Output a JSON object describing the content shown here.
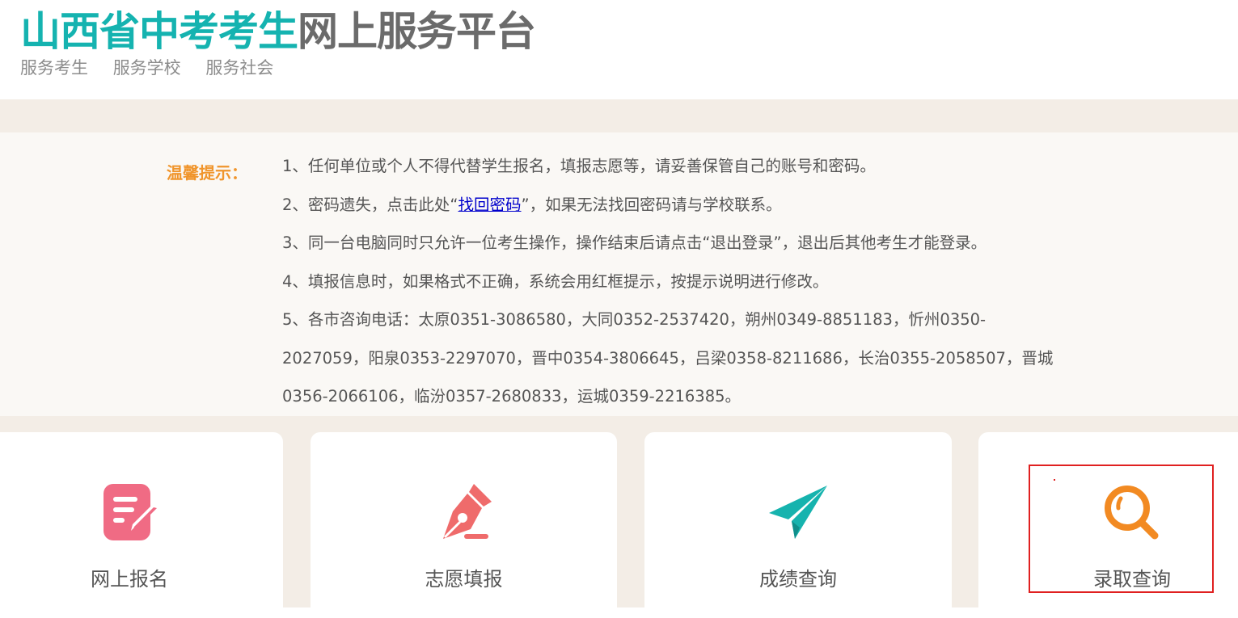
{
  "header": {
    "title_part1": "山西省中考考生",
    "title_part2": "网上服务平台",
    "subnav": [
      "服务考生",
      "服务学校",
      "服务社会"
    ]
  },
  "notice": {
    "label": "温馨提示：",
    "line1": "1、任何单位或个人不得代替学生报名，填报志愿等，请妥善保管自己的账号和密码。",
    "line2_before": "2、密码遗失，点击此处“",
    "line2_link": "找回密码",
    "line2_after": "”，如果无法找回密码请与学校联系。",
    "line3": "3、同一台电脑同时只允许一位考生操作，操作结束后请点击“退出登录”，退出后其他考生才能登录。",
    "line4": "4、填报信息时，如果格式不正确，系统会用红框提示，按提示说明进行修改。",
    "line5": "5、各市咨询电话：太原0351-3086580，大同0352-2537420，朔州0349-8851183，忻州0350-2027059，阳泉0353-2297070，晋中0354-3806645，吕梁0358-8211686，长治0355-2058507，晋城0356-2066106，临汾0357-2680833，运城0359-2216385。"
  },
  "cards": [
    {
      "label": "网上报名",
      "icon": "registration-icon",
      "color": "#f06b84"
    },
    {
      "label": "志愿填报",
      "icon": "fountain-pen-icon",
      "color": "#ef6b6b"
    },
    {
      "label": "成绩查询",
      "icon": "paper-plane-icon",
      "color": "#16b3ae"
    },
    {
      "label": "录取查询",
      "icon": "magnifier-icon",
      "color": "#f28a22"
    }
  ]
}
